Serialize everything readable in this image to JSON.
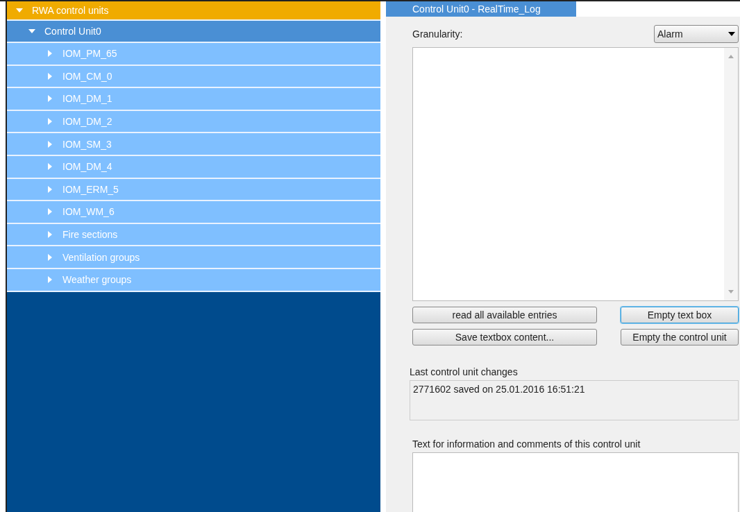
{
  "tree": [
    {
      "label": "RWA control units",
      "expanded": true,
      "selected": true,
      "children": [
        {
          "label": "Control Unit0",
          "expanded": true,
          "selected": false,
          "children": [
            {
              "label": "IOM_PM_65",
              "expanded": false,
              "selected": false
            },
            {
              "label": "IOM_CM_0",
              "expanded": false,
              "selected": false
            },
            {
              "label": "IOM_DM_1",
              "expanded": false,
              "selected": false
            },
            {
              "label": "IOM_DM_2",
              "expanded": false,
              "selected": false
            },
            {
              "label": "IOM_SM_3",
              "expanded": false,
              "selected": false
            },
            {
              "label": "IOM_DM_4",
              "expanded": false,
              "selected": false
            },
            {
              "label": "IOM_ERM_5",
              "expanded": false,
              "selected": false
            },
            {
              "label": "IOM_WM_6",
              "expanded": false,
              "selected": false
            },
            {
              "label": "Fire sections",
              "expanded": false,
              "selected": false
            },
            {
              "label": "Ventilation groups",
              "expanded": false,
              "selected": false
            },
            {
              "label": "Weather groups",
              "expanded": false,
              "selected": false
            }
          ]
        }
      ]
    }
  ],
  "tabs": [
    {
      "label": "Control Unit0 - RealTime_Log",
      "selected": true
    }
  ],
  "granularity": {
    "label": "Granularity:",
    "value": "Alarm"
  },
  "buttons": [
    {
      "label": "read all available entries",
      "focused": false
    },
    {
      "label": "Empty text box",
      "focused": true
    },
    {
      "label": "Save textbox content...",
      "focused": false
    },
    {
      "label": "Empty the control unit",
      "focused": false
    }
  ],
  "last_changes": {
    "label": "Last control unit changes",
    "value": "2771602 saved on 25.01.2016 16:51:21"
  },
  "comments": {
    "label": "Text for information and comments of this control unit"
  }
}
